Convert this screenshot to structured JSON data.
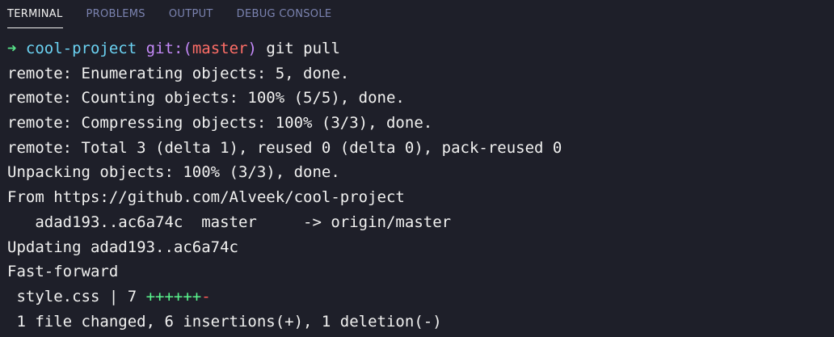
{
  "tabs": [
    {
      "label": "TERMINAL",
      "active": true
    },
    {
      "label": "PROBLEMS",
      "active": false
    },
    {
      "label": "OUTPUT",
      "active": false
    },
    {
      "label": "DEBUG CONSOLE",
      "active": false
    }
  ],
  "prompt": {
    "arrow": "➜",
    "dir": "cool-project",
    "git_prefix": "git:(",
    "branch": "master",
    "git_suffix": ")",
    "command": "git pull"
  },
  "output": [
    "remote: Enumerating objects: 5, done.",
    "remote: Counting objects: 100% (5/5), done.",
    "remote: Compressing objects: 100% (3/3), done.",
    "remote: Total 3 (delta 1), reused 0 (delta 0), pack-reused 0",
    "Unpacking objects: 100% (3/3), done.",
    "From https://github.com/Alveek/cool-project",
    "   adad193..ac6a74c  master     -> origin/master",
    "Updating adad193..ac6a74c",
    "Fast-forward"
  ],
  "diffstat": {
    "file": " style.css | 7 ",
    "plus": "++++++",
    "minus": "-"
  },
  "summary": " 1 file changed, 6 insertions(+), 1 deletion(-)",
  "colors": {
    "background": "#1e1f29",
    "foreground": "#f1f1f0",
    "prompt_arrow": "#57e389",
    "directory": "#6bd2f2",
    "git_label": "#c58af9",
    "branch": "#ff6e67",
    "insertions": "#5af78e",
    "deletions": "#ff5c57",
    "inactive_tab": "#7b83b0"
  }
}
